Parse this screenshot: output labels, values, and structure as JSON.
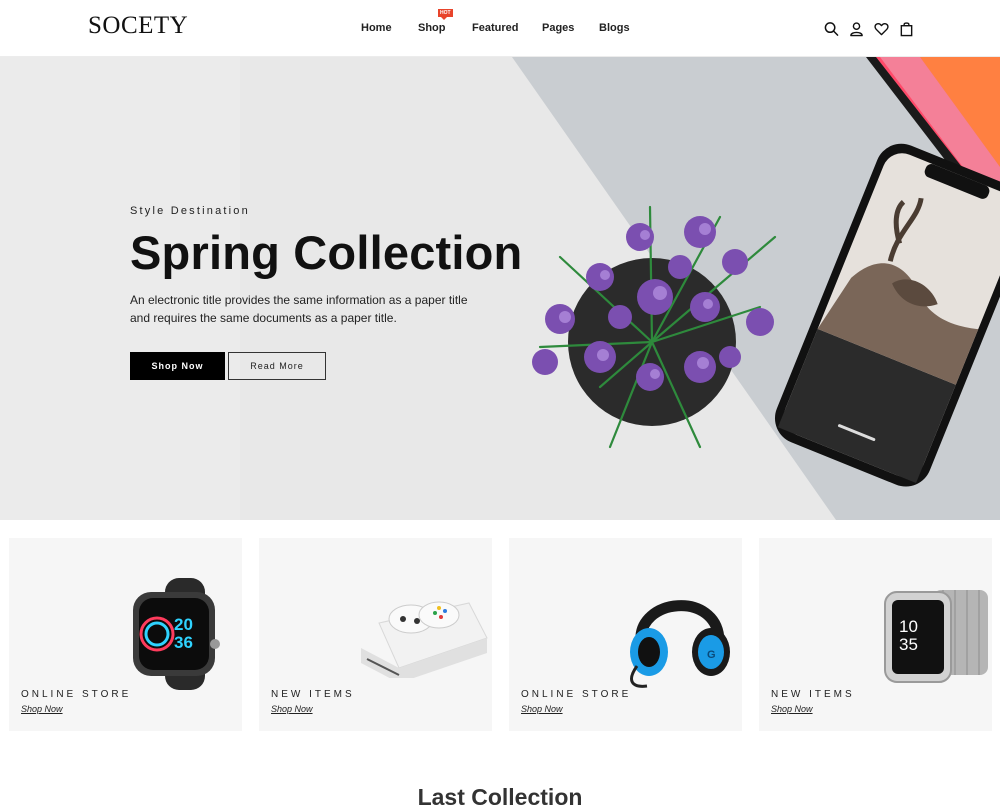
{
  "brand": {
    "logo": "SOCETY"
  },
  "nav": {
    "items": [
      {
        "label": "Home"
      },
      {
        "label": "Shop",
        "badge": "HOT"
      },
      {
        "label": "Featured"
      },
      {
        "label": "Pages"
      },
      {
        "label": "Blogs"
      }
    ]
  },
  "header_icons": [
    "search-icon",
    "user-icon",
    "heart-icon",
    "shopping-bag-icon"
  ],
  "hero": {
    "eyebrow": "Style Destination",
    "title": "Spring Collection",
    "description": "An electronic title provides the same information as a paper title and requires the same documents as a paper title.",
    "primary_button": "Shop Now",
    "secondary_button": "Read More"
  },
  "cards": [
    {
      "label": "ONLINE STORE",
      "link": "Shop Now",
      "image": "smartwatch",
      "watch_time": "20 36"
    },
    {
      "label": "NEW ITEMS",
      "link": "Shop Now",
      "image": "game-console"
    },
    {
      "label": "ONLINE STORE",
      "link": "Shop Now",
      "image": "headphones"
    },
    {
      "label": "NEW ITEMS",
      "link": "Shop Now",
      "image": "smartwatch-silver",
      "watch_time": "10 35"
    }
  ],
  "section": {
    "title": "Last Collection"
  },
  "colors": {
    "accent": "#000000",
    "hot_badge": "#e8442b",
    "hero_bg": "#e9e9e9",
    "card_bg": "#f6f6f6"
  }
}
